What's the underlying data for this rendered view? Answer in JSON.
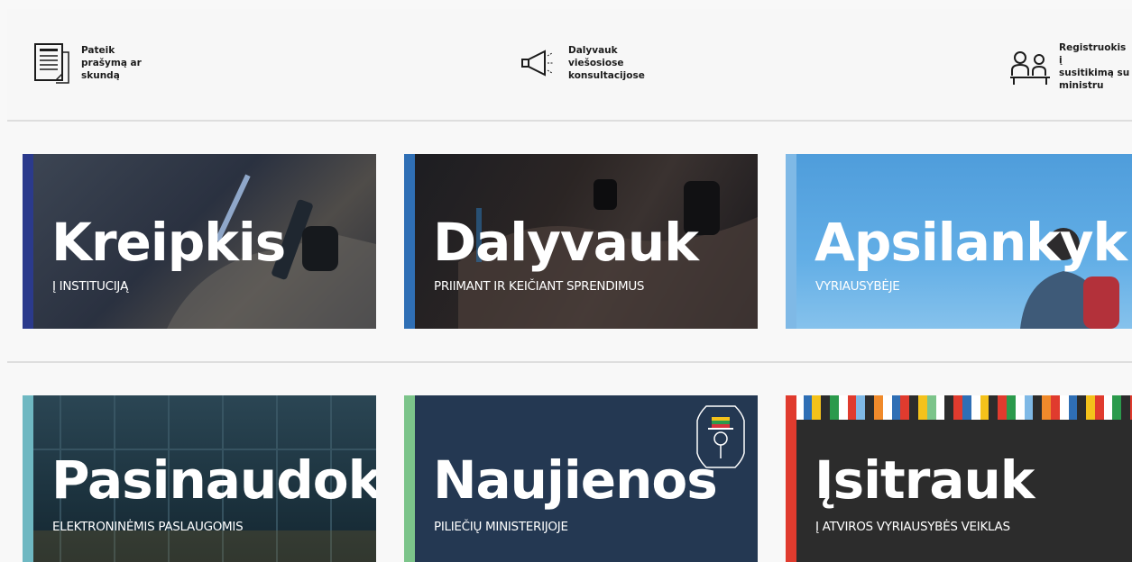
{
  "quick_links": [
    {
      "label": "Pateik\nprašymą ar\nskundą",
      "icon": "document-form-icon"
    },
    {
      "label": "Dalyvauk\nviešosiose\nkonsultacijose",
      "icon": "megaphone-icon"
    },
    {
      "label": "Registruokis į\nsusitikimą su\nministru",
      "icon": "meeting-people-icon"
    }
  ],
  "cards": [
    {
      "title": "Kreipkis",
      "subtitle": "Į INSTITUCIJĄ",
      "accent": "#2b3a8c"
    },
    {
      "title": "Dalyvauk",
      "subtitle": "PRIIMANT IR KEIČIANT SPRENDIMUS",
      "accent": "#2f6fb5"
    },
    {
      "title": "Apsilankyk",
      "subtitle": "VYRIAUSYBĖJE",
      "accent": "#7fb9e6"
    },
    {
      "title": "Pasinaudok",
      "subtitle": "ELEKTRONINĖMIS PASLAUGOMIS",
      "accent": "#6fb8c2"
    },
    {
      "title": "Naujienos",
      "subtitle": "PILIEČIŲ MINISTERIJOJE",
      "accent": "#7cc48a"
    },
    {
      "title": "Įsitrauk",
      "subtitle": "Į ATVIROS VYRIAUSYBĖS VEIKLAS",
      "accent": "#e03b2e"
    }
  ],
  "colors": {
    "card_kreipkis": "#27313f",
    "card_dalyvauk": "#1a1718",
    "card_apsilankyk": "#5aa7e1",
    "card_pasinaudok": "#1d3440",
    "card_naujienos": "#243852",
    "card_isitrauk": "#2c2c2c"
  }
}
